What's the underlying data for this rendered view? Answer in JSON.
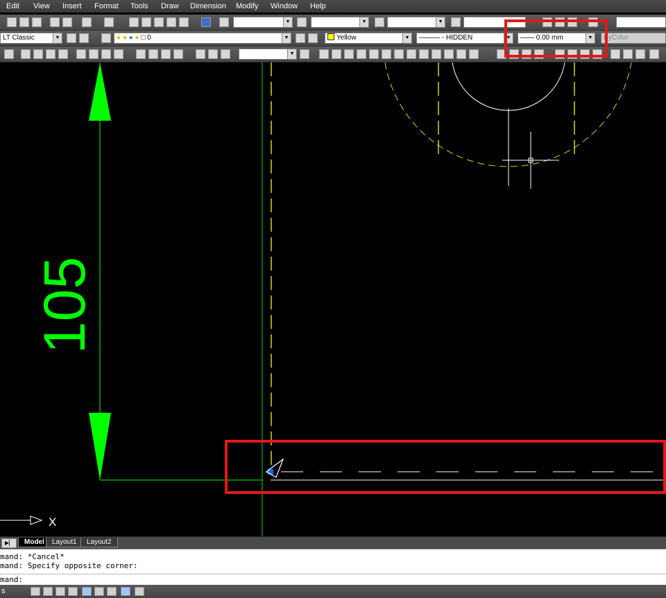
{
  "menubar": {
    "items": [
      "Edit",
      "View",
      "Insert",
      "Format",
      "Tools",
      "Draw",
      "Dimension",
      "Modify",
      "Window",
      "Help"
    ]
  },
  "toolbar2": {
    "workspace": "LT Classic",
    "layer": "0",
    "color": "Yellow",
    "color_hex": "#ffff00",
    "linetype": "HIDDEN",
    "lineweight": "0.00 mm",
    "plotstyle": "ByColor"
  },
  "canvas": {
    "dimension_value": "105",
    "dimension_color": "#00ff00",
    "axis_label": "X"
  },
  "layout_tabs": [
    "Model",
    "Layout1",
    "Layout2"
  ],
  "command": {
    "lines": [
      "mand: *Cancel*",
      "mand: Specify opposite corner:"
    ],
    "prompt": "mand:"
  },
  "status": {
    "left_text": "s"
  },
  "highlight_color": "#e11a1a"
}
